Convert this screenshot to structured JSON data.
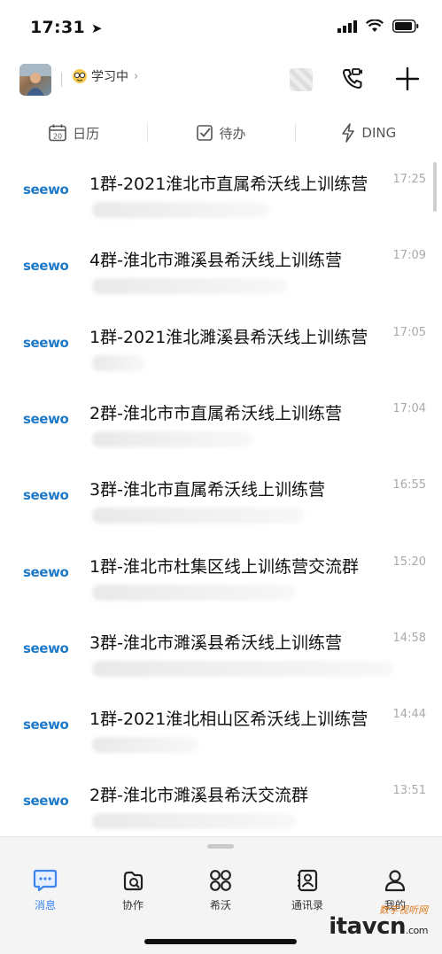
{
  "status_bar": {
    "time": "17:31"
  },
  "header": {
    "presence_label": "学习中",
    "presence_chevron": "›"
  },
  "quick_actions": [
    {
      "label": "日历",
      "icon": "calendar-icon",
      "day": "20"
    },
    {
      "label": "待办",
      "icon": "todo-check-icon"
    },
    {
      "label": "DING",
      "icon": "ding-lightning-icon"
    }
  ],
  "chats": [
    {
      "logo": "seewo",
      "title": "1群-2021淮北市直属希沃线上训练营",
      "time": "17:25"
    },
    {
      "logo": "seewo",
      "title": "4群-淮北市濉溪县希沃线上训练营",
      "time": "17:09"
    },
    {
      "logo": "seewo",
      "title": "1群-2021淮北濉溪县希沃线上训练营",
      "time": "17:05"
    },
    {
      "logo": "seewo",
      "title": "2群-淮北市市直属希沃线上训练营",
      "time": "17:04"
    },
    {
      "logo": "seewo",
      "title": "3群-淮北市直属希沃线上训练营",
      "time": "16:55"
    },
    {
      "logo": "seewo",
      "title": "1群-淮北市杜集区线上训练营交流群",
      "time": "15:20"
    },
    {
      "logo": "seewo",
      "title": "3群-淮北市濉溪县希沃线上训练营",
      "time": "14:58"
    },
    {
      "logo": "seewo",
      "title": "1群-2021淮北相山区希沃线上训练营",
      "time": "14:44"
    },
    {
      "logo": "seewo",
      "title": "2群-淮北市濉溪县希沃交流群",
      "time": "13:51"
    }
  ],
  "tabs": [
    {
      "label": "消息",
      "icon": "message-icon",
      "active": true
    },
    {
      "label": "协作",
      "icon": "collaboration-icon"
    },
    {
      "label": "希沃",
      "icon": "apps-grid-icon"
    },
    {
      "label": "通讯录",
      "icon": "contacts-icon"
    },
    {
      "label": "我的",
      "icon": "profile-icon"
    }
  ],
  "watermark": {
    "text": "itavcn",
    "suffix": ".com",
    "tag": "数字视听网"
  },
  "colors": {
    "accent": "#3d86f0",
    "logo_blue": "#1e7ac8",
    "tabbar_bg": "#f4f4f4"
  }
}
